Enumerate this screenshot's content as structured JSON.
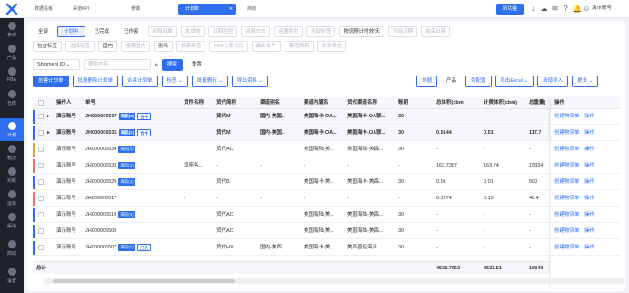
{
  "topbar": {
    "tabs": [
      {
        "label": "数据看板"
      },
      {
        "label": "渠道KPI"
      },
      {
        "label": "参谋"
      },
      {
        "label": "计划单"
      },
      {
        "label": "商城"
      }
    ],
    "new_feature": "新功能",
    "user": "演示账号"
  },
  "sidebar": [
    {
      "label": "参谋"
    },
    {
      "label": "产品"
    },
    {
      "label": "FBA"
    },
    {
      "label": "仓库"
    },
    {
      "label": "计划"
    },
    {
      "label": "物流"
    },
    {
      "label": "对账"
    },
    {
      "label": "运单"
    },
    {
      "label": "渠道"
    },
    {
      "label": "商城"
    },
    {
      "label": "设置"
    }
  ],
  "filters": {
    "status": [
      "全部",
      "计划中",
      "已完成",
      "已作废"
    ],
    "row1_selects": [
      "权限归属",
      "发货地",
      "日期类型",
      "运输方式",
      "运输类型",
      "全部标签"
    ],
    "row1_date_type": "物流预计时效/天",
    "row1_date_start": "开始日期",
    "row1_date_end": "结束日期",
    "row2": [
      {
        "label": "包含标签",
        "placeholder": "选择标签"
      },
      {
        "label": "国内",
        "placeholder": "搜索国内"
      },
      {
        "label": "别名",
        "placeholder": "搜索渠道"
      }
    ],
    "row2_more": [
      "FBA仓库代码",
      "最新单号",
      "集团周期",
      "索引状态"
    ],
    "search_field": "Shipment ID",
    "search_placeholder": "搜索内容",
    "search_btn": "搜索",
    "reset_btn": "重置"
  },
  "toolbar": {
    "left": [
      "创建计划单",
      "批量删除计划单",
      "合并计划单",
      "标签",
      "批量删行",
      "导出资料"
    ],
    "right": [
      "单据",
      "产品",
      "列配置",
      "导出Excel",
      "新增导入",
      "更多"
    ]
  },
  "table": {
    "headers": [
      "操作人",
      "单号",
      "货件名称",
      "货代简称",
      "渠道别名",
      "渠道内置名",
      "货代渠道名称",
      "账期",
      "总体积(cbm)",
      "计费体积(cbm)",
      "总重量(",
      "操作"
    ],
    "rows": [
      {
        "group": true,
        "user": "演示账号",
        "no": "JH000006537",
        "tags": [
          "海航(3)",
          "合并"
        ],
        "goods": "",
        "agent": "货代M",
        "alias": "国内-美国...",
        "builtin": "美国海卡-OA...",
        "channel": "美国海卡-OA联...",
        "period": "30",
        "vol": "-",
        "cvol": "-",
        "weight": "-",
        "op": [
          "创建物流单",
          "操作"
        ],
        "color": "#2f6fed"
      },
      {
        "group": true,
        "user": "演示账号",
        "no": "JH000006535",
        "tags": [
          "海航(2)",
          "合并"
        ],
        "goods": "",
        "agent": "货代M",
        "alias": "国内-美国...",
        "builtin": "美国海卡-OA...",
        "channel": "美国海卡-OA联...",
        "period": "30",
        "vol": "0.5144",
        "cvol": "0.51",
        "weight": "117.7",
        "op": [
          "创建物流单",
          "操作"
        ],
        "color": "#2f6fed"
      },
      {
        "group": false,
        "user": "演示账号",
        "no": "JH000006534",
        "tags": [
          "海航(1)"
        ],
        "goods": "",
        "agent": "货代AC",
        "alias": "",
        "builtin": "美国海陆-美...",
        "channel": "美国海陆-美森...",
        "period": "30",
        "vol": "-",
        "cvol": "-",
        "weight": "-",
        "op": [
          "创建物流单",
          "操作"
        ],
        "color": "#e6a23c"
      },
      {
        "group": false,
        "user": "演示账号",
        "no": "JH000006533",
        "tags": [
          "海航(1)"
        ],
        "goods": "双座售...",
        "agent": "-",
        "alias": "-",
        "builtin": "-",
        "channel": "-",
        "period": "-",
        "vol": "163.7367",
        "cvol": "163.74",
        "weight": "15834",
        "op": [
          "创建物流单",
          "操作"
        ],
        "color": "#f56c6c"
      },
      {
        "group": false,
        "user": "演示账号",
        "no": "JH000006529",
        "tags": [
          "海航(1)"
        ],
        "goods": "",
        "agent": "货代B",
        "alias": "",
        "builtin": "美国海卡-美...",
        "channel": "美国海卡-美森...",
        "period": "30",
        "vol": "0.01",
        "cvol": "0.01",
        "weight": "500",
        "op": [
          "创建物流单",
          "操作"
        ],
        "color": "#2f6fed"
      },
      {
        "group": false,
        "user": "演示账号",
        "no": "JH000006517",
        "tags": [],
        "goods": "-",
        "agent": "-",
        "alias": "-",
        "builtin": "-",
        "channel": "-",
        "period": "-",
        "vol": "0.1274",
        "cvol": "0.13",
        "weight": "48.4",
        "op": [
          "创建物流单",
          "操作"
        ],
        "color": "#f56c6c"
      },
      {
        "group": false,
        "user": "演示账号",
        "no": "JH000006510",
        "tags": [
          "海航(1)"
        ],
        "goods": "",
        "agent": "货代AC",
        "alias": "",
        "builtin": "美国海陆-美...",
        "channel": "美国海陆-美森...",
        "period": "30",
        "vol": "-",
        "cvol": "-",
        "weight": "-",
        "op": [
          "创建物流单",
          "操作"
        ],
        "color": "#2f6fed"
      },
      {
        "group": false,
        "user": "演示账号",
        "no": "JH000006509",
        "tags": [],
        "goods": "",
        "agent": "货代AC",
        "alias": "",
        "builtin": "美国海陆-美...",
        "channel": "美国海陆-美森...",
        "period": "30",
        "vol": "-",
        "cvol": "-",
        "weight": "-",
        "op": [
          "创建物流单",
          "操作"
        ],
        "color": "#2f6fed"
      },
      {
        "group": false,
        "user": "演示账号",
        "no": "JH000006507",
        "tags": [
          "海航(1)",
          "已结"
        ],
        "goods": "",
        "agent": "货代HX",
        "alias": "国内-美西...",
        "builtin": "美国海卡-美...",
        "channel": "美西普船海派",
        "period": "30",
        "vol": "-",
        "cvol": "-",
        "weight": "-",
        "op": [
          "创建物流单",
          "操作"
        ],
        "color": "#2f6fed"
      }
    ],
    "total": {
      "label": "总计",
      "vol": "4538.7052",
      "cvol": "4531.51",
      "weight": "18849"
    }
  }
}
